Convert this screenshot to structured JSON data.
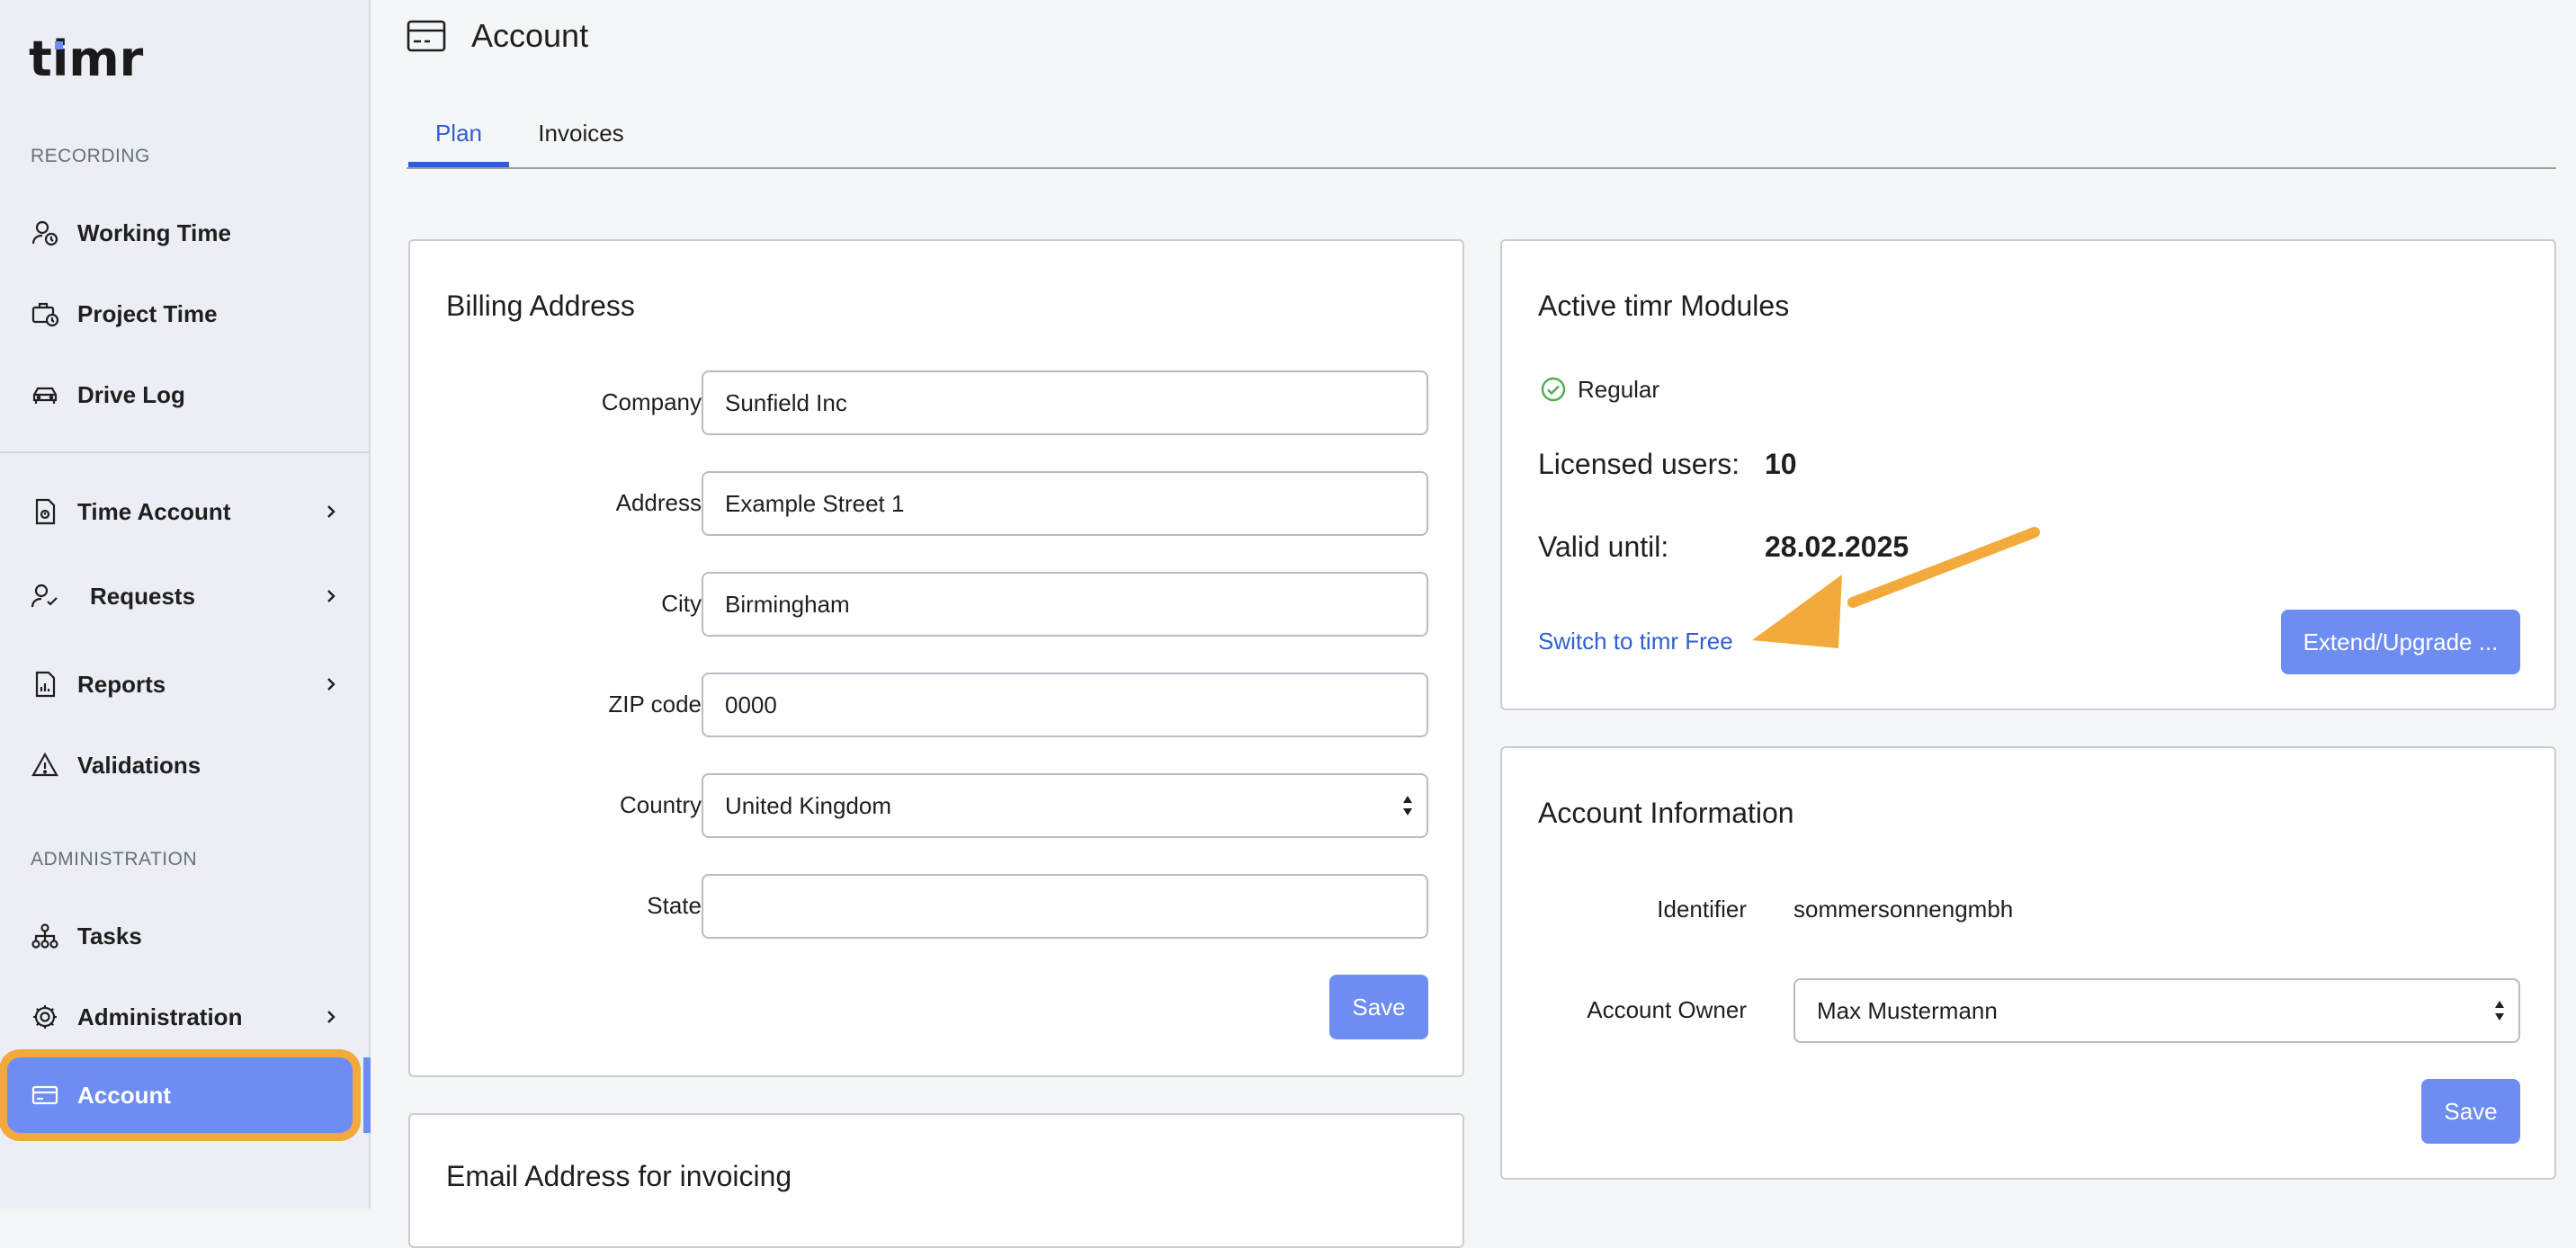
{
  "sidebar": {
    "logo_text": "timr",
    "sections": {
      "recording": "RECORDING",
      "administration": "ADMINISTRATION"
    },
    "items": [
      {
        "label": "Working Time",
        "icon": "user-clock-icon"
      },
      {
        "label": "Project Time",
        "icon": "briefcase-clock-icon"
      },
      {
        "label": "Drive Log",
        "icon": "car-icon"
      },
      {
        "label": "Time Account",
        "icon": "document-clock-icon"
      },
      {
        "label": "Requests",
        "icon": "user-check-icon"
      },
      {
        "label": "Reports",
        "icon": "report-icon"
      },
      {
        "label": "Validations",
        "icon": "warning-icon"
      },
      {
        "label": "Tasks",
        "icon": "hierarchy-icon"
      },
      {
        "label": "Administration",
        "icon": "gear-icon"
      },
      {
        "label": "Account",
        "icon": "credit-card-icon"
      }
    ]
  },
  "header": {
    "title": "Account",
    "icon": "credit-card-icon"
  },
  "tabs": [
    {
      "label": "Plan"
    },
    {
      "label": "Invoices"
    }
  ],
  "billing": {
    "title": "Billing Address",
    "fields": {
      "company": {
        "label": "Company",
        "value": "Sunfield Inc"
      },
      "address": {
        "label": "Address",
        "value": "Example Street 1"
      },
      "city": {
        "label": "City",
        "value": "Birmingham"
      },
      "zip": {
        "label": "ZIP code",
        "value": "0000"
      },
      "country": {
        "label": "Country",
        "value": "United Kingdom"
      },
      "state": {
        "label": "State",
        "value": ""
      }
    },
    "save_label": "Save"
  },
  "email_card": {
    "title": "Email Address for invoicing"
  },
  "modules": {
    "title": "Active timr Modules",
    "module_name": "Regular",
    "licensed_label": "Licensed users:",
    "licensed_value": "10",
    "valid_label": "Valid until:",
    "valid_value": "28.02.2025",
    "switch_link": "Switch to timr Free",
    "extend_label": "Extend/Upgrade ..."
  },
  "account_info": {
    "title": "Account Information",
    "identifier_label": "Identifier",
    "identifier_value": "sommersonnengmbh",
    "owner_label": "Account Owner",
    "owner_value": "Max Mustermann",
    "save_label": "Save"
  },
  "colors": {
    "accent": "#6e8df2",
    "link": "#2f5fd0",
    "highlight": "#f3a93b",
    "success": "#4caf50"
  }
}
